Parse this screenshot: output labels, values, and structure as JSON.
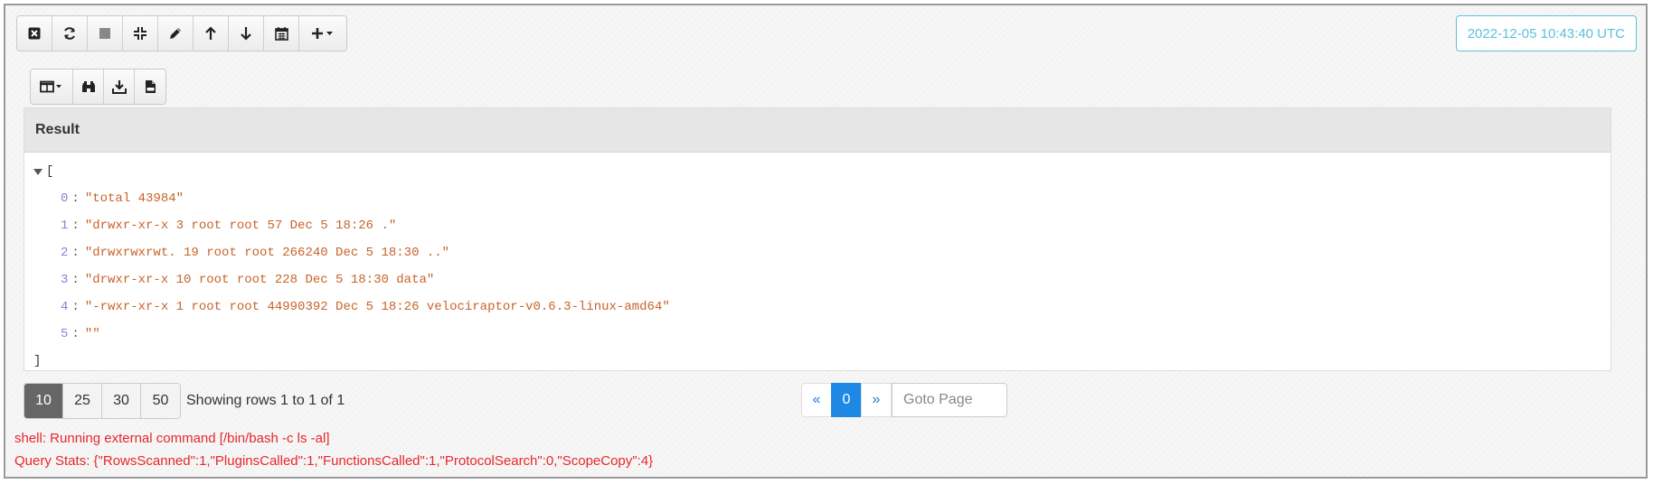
{
  "toolbar": {
    "buttons": [
      {
        "icon": "close-square-icon"
      },
      {
        "icon": "refresh-icon"
      },
      {
        "icon": "stop-icon"
      },
      {
        "icon": "compress-icon"
      },
      {
        "icon": "pencil-icon"
      },
      {
        "icon": "arrow-up-icon"
      },
      {
        "icon": "arrow-down-icon"
      },
      {
        "icon": "calendar-icon"
      },
      {
        "icon": "plus-dropdown-icon"
      }
    ]
  },
  "timestamp": "2022-12-05 10:43:40 UTC",
  "subtoolbar": {
    "buttons": [
      {
        "icon": "columns-dropdown-icon"
      },
      {
        "icon": "binoculars-icon"
      },
      {
        "icon": "download-icon"
      },
      {
        "icon": "csv-file-icon"
      }
    ]
  },
  "result": {
    "header": "Result",
    "open_bracket": "[",
    "close_bracket": "]",
    "items": [
      {
        "index": "0",
        "value": "\"total 43984\""
      },
      {
        "index": "1",
        "value": "\"drwxr-xr-x 3 root root 57 Dec 5 18:26 .\""
      },
      {
        "index": "2",
        "value": "\"drwxrwxrwt. 19 root root 266240 Dec 5 18:30 ..\""
      },
      {
        "index": "3",
        "value": "\"drwxr-xr-x 10 root root 228 Dec 5 18:30 data\""
      },
      {
        "index": "4",
        "value": "\"-rwxr-xr-x 1 root root 44990392 Dec 5 18:26 velociraptor-v0.6.3-linux-amd64\""
      },
      {
        "index": "5",
        "value": "\"\""
      }
    ]
  },
  "pagination": {
    "page_sizes": [
      "10",
      "25",
      "30",
      "50"
    ],
    "active_size": "10",
    "rows_info": "Showing rows 1 to 1 of 1",
    "prev": "«",
    "current_page": "0",
    "next": "»",
    "goto_placeholder": "Goto Page"
  },
  "log": {
    "line1": "shell: Running external command [/bin/bash -c ls -al]",
    "line2": "Query Stats: {\"RowsScanned\":1,\"PluginsCalled\":1,\"FunctionsCalled\":1,\"ProtocolSearch\":0,\"ScopeCopy\":4}"
  },
  "colors": {
    "log_error": "#e8272d",
    "timestamp_accent": "#5bc0de",
    "active_page": "#1e88e5",
    "json_string": "#c7642a",
    "json_index": "#7d8ad0"
  }
}
